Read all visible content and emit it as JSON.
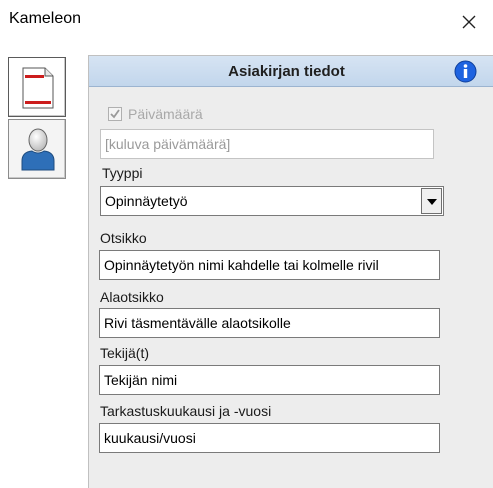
{
  "window": {
    "title": "Kameleon"
  },
  "icons": {
    "close": "close-icon",
    "document_tab": "document-icon",
    "person_tab": "person-icon",
    "info": "info-icon",
    "check": "checkmark-icon",
    "dropdown": "dropdown-arrow-icon"
  },
  "colors": {
    "accent": "#1e63e0",
    "header_bg": "#c9dbef",
    "document_red": "#cc1d1d"
  },
  "panel": {
    "title": "Asiakirjan tiedot"
  },
  "fields": {
    "date": {
      "checkbox_label": "Päivämäärä",
      "checked": true,
      "value": "[kuluva päivämäärä]"
    },
    "type": {
      "label": "Tyyppi",
      "value": "Opinnäytetyö"
    },
    "title": {
      "label": "Otsikko",
      "value": "Opinnäytetyön nimi kahdelle tai kolmelle rivil"
    },
    "subtitle": {
      "label": "Alaotsikko",
      "value": "Rivi täsmentävälle alaotsikolle"
    },
    "author": {
      "label": "Tekijä(t)",
      "value": "Tekijän nimi"
    },
    "month_year": {
      "label": "Tarkastuskuukausi ja -vuosi",
      "value": "kuukausi/vuosi"
    }
  }
}
